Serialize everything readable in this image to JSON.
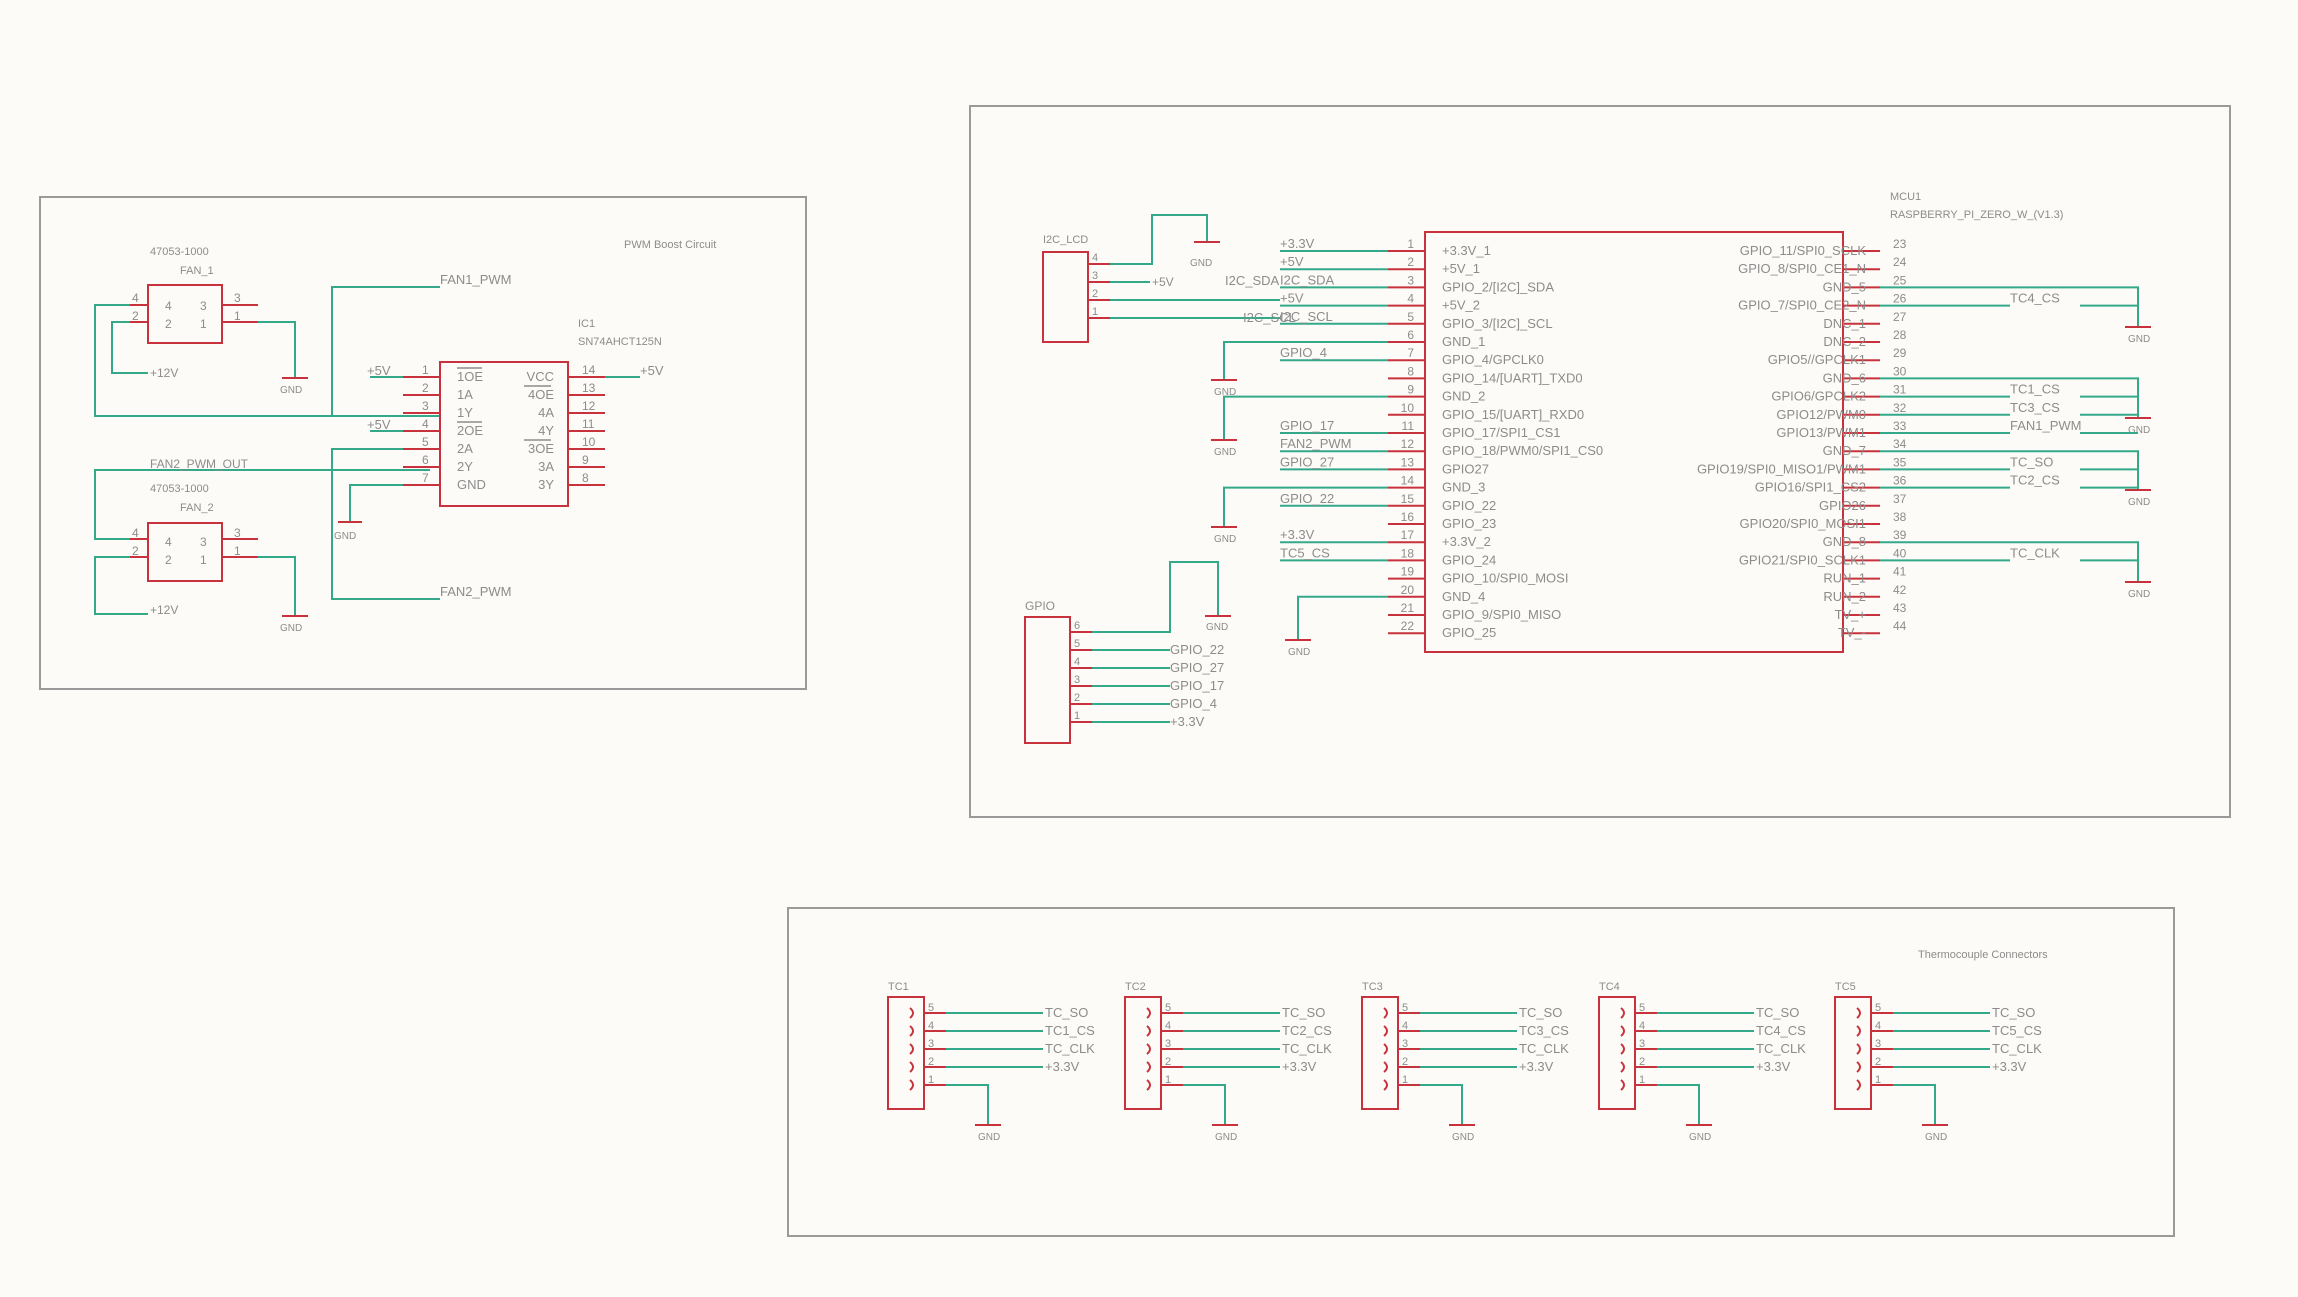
{
  "colors": {
    "background": "#fcfbf7",
    "component": "#c8323c",
    "wire": "#33a98a",
    "frame": "#9a9a9a",
    "text": "#8c8c8c"
  },
  "pwm": {
    "title": "PWM Boost Circuit",
    "fan1": {
      "part": "47053-1000",
      "ref": "FAN_1",
      "pins": [
        "4",
        "3",
        "2",
        "1"
      ],
      "body_pins": [
        "4",
        "3",
        "2",
        "1"
      ],
      "gnd": "GND",
      "supply": "+12V"
    },
    "fan2": {
      "part": "47053-1000",
      "ref": "FAN_2",
      "pins": [
        "4",
        "3",
        "2",
        "1"
      ],
      "body_pins": [
        "4",
        "3",
        "2",
        "1"
      ],
      "gnd": "GND",
      "supply": "+12V"
    },
    "ic": {
      "ref": "IC1",
      "part": "SN74AHCT125N",
      "left_pins": [
        {
          "num": "1",
          "name": "1OE"
        },
        {
          "num": "2",
          "name": "1A"
        },
        {
          "num": "3",
          "name": "1Y"
        },
        {
          "num": "4",
          "name": "2OE"
        },
        {
          "num": "5",
          "name": "2A"
        },
        {
          "num": "6",
          "name": "2Y"
        },
        {
          "num": "7",
          "name": "GND"
        }
      ],
      "right_pins": [
        {
          "num": "14",
          "name": "VCC"
        },
        {
          "num": "13",
          "name": "4OE"
        },
        {
          "num": "12",
          "name": "4A"
        },
        {
          "num": "11",
          "name": "4Y"
        },
        {
          "num": "10",
          "name": "3OE"
        },
        {
          "num": "9",
          "name": "3A"
        },
        {
          "num": "8",
          "name": "3Y"
        }
      ]
    },
    "nets": {
      "fan1_pwm": "FAN1_PWM",
      "fan2_pwm": "FAN2_PWM",
      "fan2_pwm_out": "FAN2_PWM_OUT",
      "p5v_1": "+5V",
      "p5v_4": "+5V",
      "p5v_14": "+5V",
      "gnd": "GND"
    }
  },
  "mcu": {
    "ref": "MCU1",
    "part": "RASPBERRY_PI_ZERO_W_(V1.3)",
    "left_pins": [
      {
        "num": "1",
        "name": "+3.3V_1",
        "net": "+3.3V"
      },
      {
        "num": "2",
        "name": "+5V_1",
        "net": "+5V"
      },
      {
        "num": "3",
        "name": "GPIO_2/[I2C]_SDA",
        "net": "I2C_SDA"
      },
      {
        "num": "4",
        "name": "+5V_2",
        "net": "+5V"
      },
      {
        "num": "5",
        "name": "GPIO_3/[I2C]_SCL",
        "net": "I2C_SCL"
      },
      {
        "num": "6",
        "name": "GND_1",
        "net": ""
      },
      {
        "num": "7",
        "name": "GPIO_4/GPCLK0",
        "net": "GPIO_4"
      },
      {
        "num": "8",
        "name": "GPIO_14/[UART]_TXD0",
        "net": ""
      },
      {
        "num": "9",
        "name": "GND_2",
        "net": ""
      },
      {
        "num": "10",
        "name": "GPIO_15/[UART]_RXD0",
        "net": ""
      },
      {
        "num": "11",
        "name": "GPIO_17/SPI1_CS1",
        "net": "GPIO_17"
      },
      {
        "num": "12",
        "name": "GPIO_18/PWM0/SPI1_CS0",
        "net": "FAN2_PWM"
      },
      {
        "num": "13",
        "name": "GPIO27",
        "net": "GPIO_27"
      },
      {
        "num": "14",
        "name": "GND_3",
        "net": ""
      },
      {
        "num": "15",
        "name": "GPIO_22",
        "net": "GPIO_22"
      },
      {
        "num": "16",
        "name": "GPIO_23",
        "net": ""
      },
      {
        "num": "17",
        "name": "+3.3V_2",
        "net": "+3.3V"
      },
      {
        "num": "18",
        "name": "GPIO_24",
        "net": "TC5_CS"
      },
      {
        "num": "19",
        "name": "GPIO_10/SPI0_MOSI",
        "net": ""
      },
      {
        "num": "20",
        "name": "GND_4",
        "net": ""
      },
      {
        "num": "21",
        "name": "GPIO_9/SPI0_MISO",
        "net": ""
      },
      {
        "num": "22",
        "name": "GPIO_25",
        "net": ""
      }
    ],
    "right_pins": [
      {
        "num": "23",
        "name": "GPIO_11/SPI0_SCLK",
        "net": ""
      },
      {
        "num": "24",
        "name": "GPIO_8/SPI0_CE1_N",
        "net": ""
      },
      {
        "num": "25",
        "name": "GND_5",
        "net": ""
      },
      {
        "num": "26",
        "name": "GPIO_7/SPI0_CE2_N",
        "net": "TC4_CS"
      },
      {
        "num": "27",
        "name": "DNC_1",
        "net": ""
      },
      {
        "num": "28",
        "name": "DNC_2",
        "net": ""
      },
      {
        "num": "29",
        "name": "GPIO5//GPCLK1",
        "net": ""
      },
      {
        "num": "30",
        "name": "GND_6",
        "net": ""
      },
      {
        "num": "31",
        "name": "GPIO6/GPCLK2",
        "net": "TC1_CS"
      },
      {
        "num": "32",
        "name": "GPIO12/PWM0",
        "net": "TC3_CS"
      },
      {
        "num": "33",
        "name": "GPIO13/PWM1",
        "net": "FAN1_PWM"
      },
      {
        "num": "34",
        "name": "GND_7",
        "net": ""
      },
      {
        "num": "35",
        "name": "GPIO19/SPI0_MISO1/PWM1",
        "net": "TC_SO"
      },
      {
        "num": "36",
        "name": "GPIO16/SPI1_CS2",
        "net": "TC2_CS"
      },
      {
        "num": "37",
        "name": "GPIO26",
        "net": ""
      },
      {
        "num": "38",
        "name": "GPIO20/SPI0_MOSI1",
        "net": ""
      },
      {
        "num": "39",
        "name": "GND_8",
        "net": ""
      },
      {
        "num": "40",
        "name": "GPIO21/SPI0_SCLK1",
        "net": "TC_CLK"
      },
      {
        "num": "41",
        "name": "RUN_1",
        "net": ""
      },
      {
        "num": "42",
        "name": "RUN_2",
        "net": ""
      },
      {
        "num": "43",
        "name": "TV_+",
        "net": ""
      },
      {
        "num": "44",
        "name": "TV_-",
        "net": ""
      }
    ],
    "i2c_lcd": {
      "ref": "I2C_LCD",
      "pins": [
        "4",
        "3",
        "2",
        "1"
      ],
      "nets": [
        "",
        "+5V",
        "I2C_SDA",
        "I2C_SCL"
      ]
    },
    "gpio_header": {
      "ref": "GPIO",
      "pins": [
        "6",
        "5",
        "4",
        "3",
        "2",
        "1"
      ],
      "nets": [
        "",
        "GPIO_22",
        "GPIO_27",
        "GPIO_17",
        "GPIO_4",
        "+3.3V"
      ]
    },
    "gnd": "GND"
  },
  "thermo": {
    "title": "Thermocouple Connectors",
    "pin_numbers": [
      "5",
      "4",
      "3",
      "2",
      "1"
    ],
    "gnd": "GND",
    "connectors": [
      {
        "ref": "TC1",
        "nets": [
          "TC_SO",
          "TC1_CS",
          "TC_CLK",
          "+3.3V"
        ]
      },
      {
        "ref": "TC2",
        "nets": [
          "TC_SO",
          "TC2_CS",
          "TC_CLK",
          "+3.3V"
        ]
      },
      {
        "ref": "TC3",
        "nets": [
          "TC_SO",
          "TC3_CS",
          "TC_CLK",
          "+3.3V"
        ]
      },
      {
        "ref": "TC4",
        "nets": [
          "TC_SO",
          "TC4_CS",
          "TC_CLK",
          "+3.3V"
        ]
      },
      {
        "ref": "TC5",
        "nets": [
          "TC_SO",
          "TC5_CS",
          "TC_CLK",
          "+3.3V"
        ]
      }
    ]
  }
}
